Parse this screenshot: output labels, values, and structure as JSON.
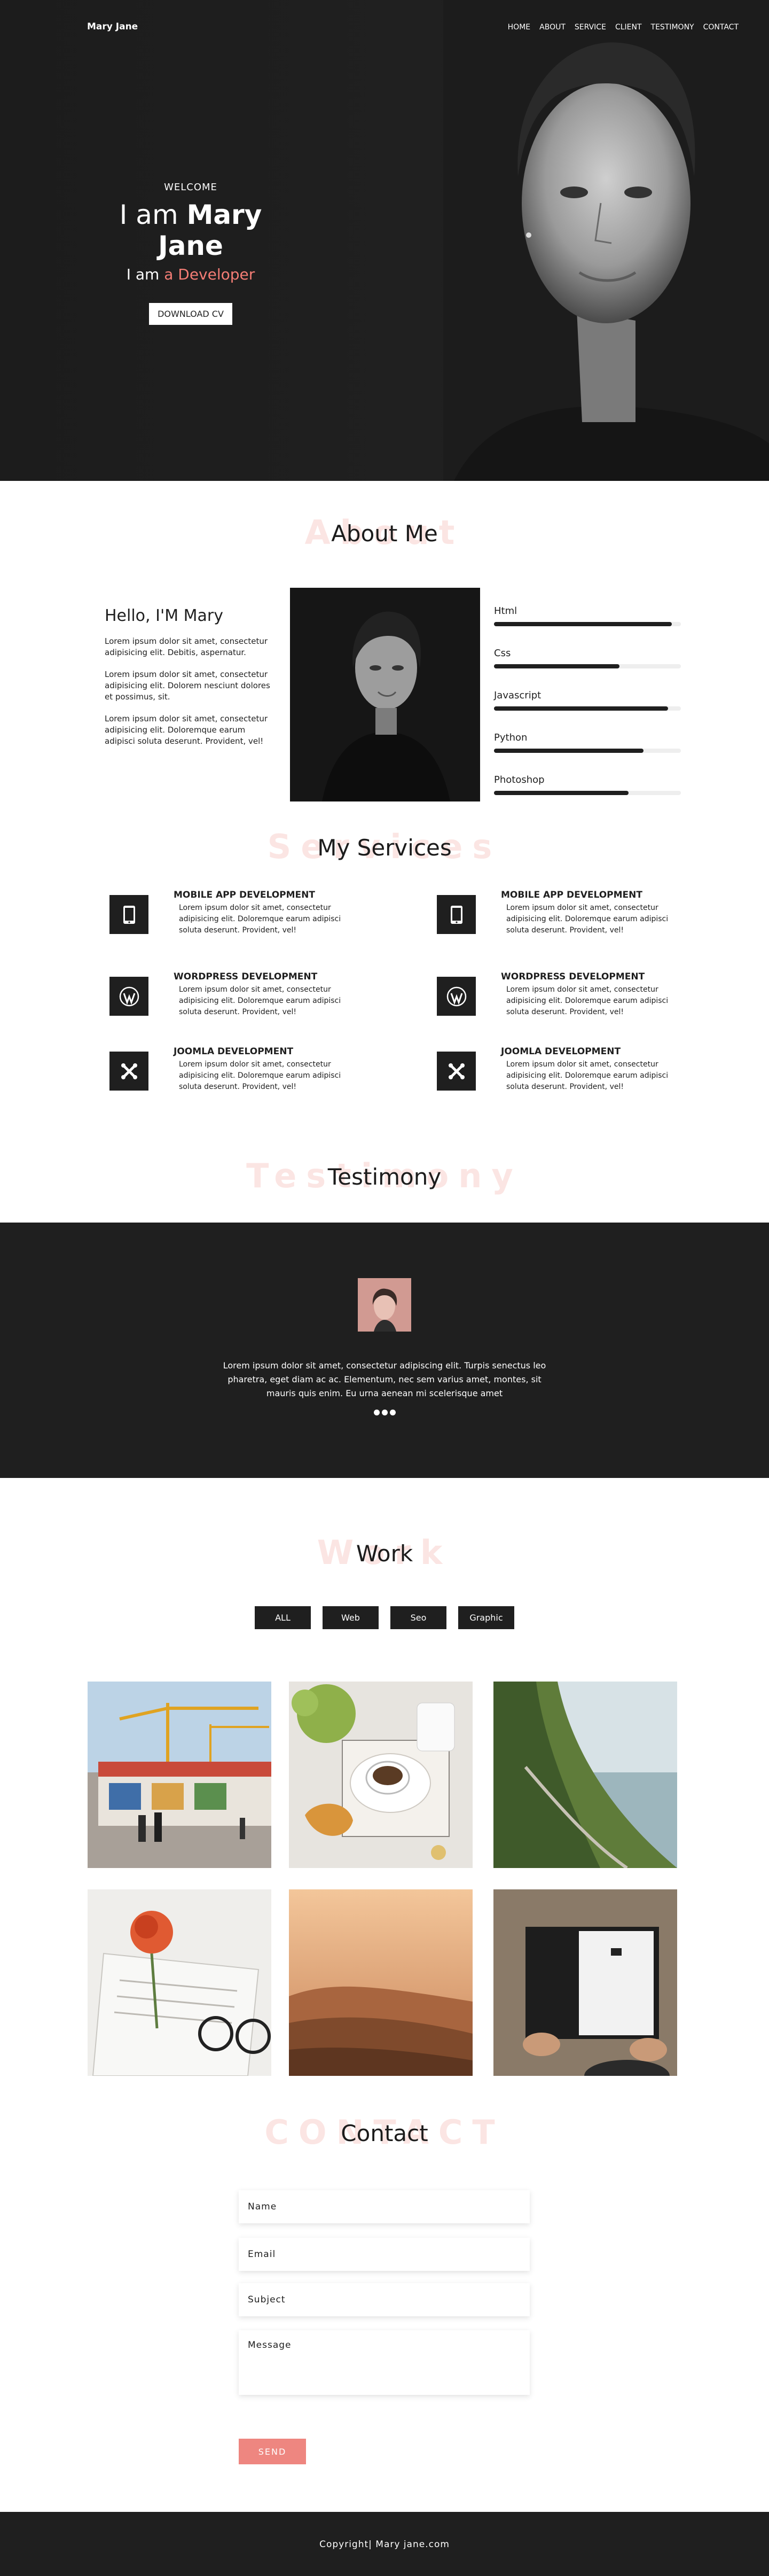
{
  "header": {
    "logo": "Mary Jane",
    "nav": [
      "HOME",
      "ABOUT",
      "SERVICE",
      "CLIENT",
      "TESTIMONY",
      "CONTACT"
    ]
  },
  "hero": {
    "welcome": "WELCOME",
    "name_prefix": "I am ",
    "name": "Mary Jane",
    "role_prefix": "I am ",
    "role": "a Developer",
    "cv_button": "DOWNLOAD CV"
  },
  "about": {
    "ghost": "About",
    "title": "About Me",
    "hello": "Hello, I'M Mary",
    "paragraphs": [
      "Lorem ipsum dolor sit amet, consectetur adipisicing elit. Debitis, aspernatur.",
      "Lorem ipsum dolor sit amet, consectetur adipisicing elit. Dolorem nesciunt dolores et possimus, sit.",
      "Lorem ipsum dolor sit amet, consectetur adipisicing elit. Doloremque earum adipisci soluta deserunt. Provident, vel!"
    ],
    "skills": [
      {
        "name": "Html",
        "level": 0.95
      },
      {
        "name": "Css",
        "level": 0.67
      },
      {
        "name": "Javascript",
        "level": 0.93
      },
      {
        "name": "Python",
        "level": 0.8
      },
      {
        "name": "Photoshop",
        "level": 0.72
      }
    ]
  },
  "services": {
    "ghost": "Services",
    "title": "My Services",
    "items": [
      {
        "title": "MOBILE APP DEVELOPMENT",
        "text": "Lorem ipsum dolor sit amet, consectetur adipisicing elit. Doloremque earum adipisci soluta deserunt. Provident, vel!",
        "icon": "mobile-icon"
      },
      {
        "title": "MOBILE APP DEVELOPMENT",
        "text": "Lorem ipsum dolor sit amet, consectetur adipisicing elit. Doloremque earum adipisci soluta deserunt. Provident, vel!",
        "icon": "mobile-icon"
      },
      {
        "title": "WORDPRESS DEVELOPMENT",
        "text": "Lorem ipsum dolor sit amet, consectetur adipisicing elit. Doloremque earum adipisci soluta deserunt. Provident, vel!",
        "icon": "wordpress-icon"
      },
      {
        "title": "WORDPRESS DEVELOPMENT",
        "text": "Lorem ipsum dolor sit amet, consectetur adipisicing elit. Doloremque earum adipisci soluta deserunt. Provident, vel!",
        "icon": "wordpress-icon"
      },
      {
        "title": "JOOMLA DEVELOPMENT",
        "text": "Lorem ipsum dolor sit amet, consectetur adipisicing elit. Doloremque earum adipisci soluta deserunt. Provident, vel!",
        "icon": "joomla-icon"
      },
      {
        "title": "JOOMLA DEVELOPMENT",
        "text": "Lorem ipsum dolor sit amet, consectetur adipisicing elit. Doloremque earum adipisci soluta deserunt. Provident, vel!",
        "icon": "joomla-icon"
      }
    ]
  },
  "testimony": {
    "ghost": "Testimony",
    "title": "Testimony",
    "quote": "Lorem ipsum dolor sit amet, consectetur adipiscing elit. Turpis senectus leo pharetra, eget diam ac ac. Elementum, nec sem varius amet, montes, sit mauris quis enim. Eu urna aenean mi scelerisque amet",
    "dots": 3
  },
  "work": {
    "ghost": "Work",
    "title": "Work",
    "filters": [
      "ALL",
      "Web",
      "Seo",
      "Graphic"
    ]
  },
  "contact": {
    "ghost": "CONTACT",
    "title": "Contact",
    "name_placeholder": "Name",
    "email_placeholder": "Email",
    "subject_placeholder": "Subject",
    "message_placeholder": "Message",
    "send": "SEND"
  },
  "footer": {
    "copyright": "Copyright| Mary jane.com"
  },
  "colors": {
    "accent": "#f47d75",
    "dark": "#1f1f1f",
    "ghost_text": "#fbe5e3",
    "send_button": "#ee8680"
  }
}
